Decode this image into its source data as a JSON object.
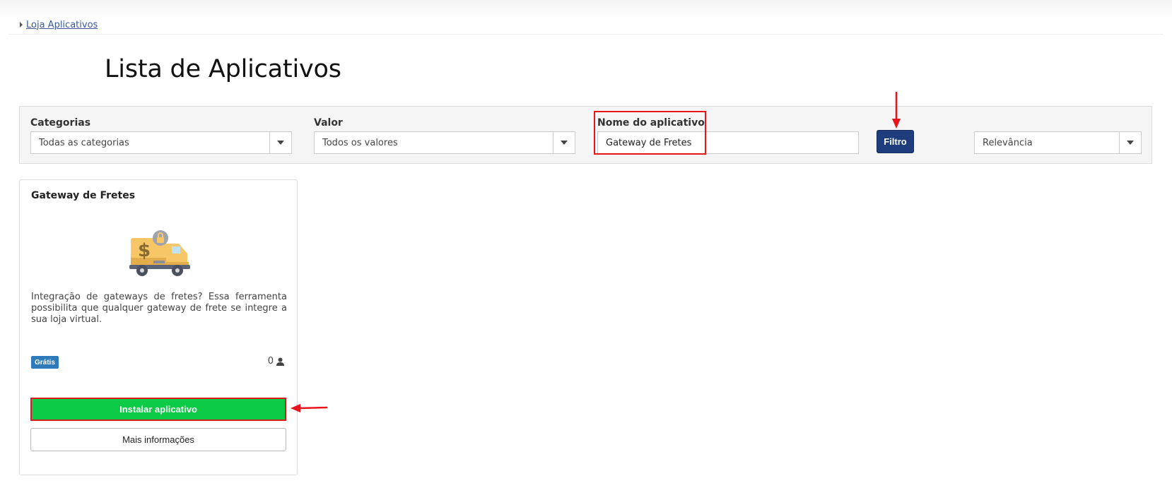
{
  "breadcrumb": {
    "link": "Loja Aplicativos"
  },
  "page": {
    "title": "Lista de Aplicativos"
  },
  "filters": {
    "categories_label": "Categorias",
    "categories_value": "Todas as categorias",
    "value_label": "Valor",
    "value_value": "Todos os valores",
    "name_label": "Nome do aplicativo",
    "name_value": "Gateway de Fretes",
    "filter_button": "Filtro",
    "sort_value": "Relevância"
  },
  "app_card": {
    "title": "Gateway de Fretes",
    "description": "Integração de gateways de fretes? Essa ferramenta possibilita que qualquer gateway de frete se integre a sua loja virtual.",
    "price_badge": "Grátis",
    "install_count": "0",
    "install_button": "Instalar aplicativo",
    "more_info_button": "Mais informações",
    "icon": "delivery-truck-dollar-lock-icon"
  },
  "colors": {
    "primary_button": "#1f3d7c",
    "install_button": "#0ccb46",
    "badge": "#2f7ab8",
    "annotation_red": "#e8131b"
  }
}
